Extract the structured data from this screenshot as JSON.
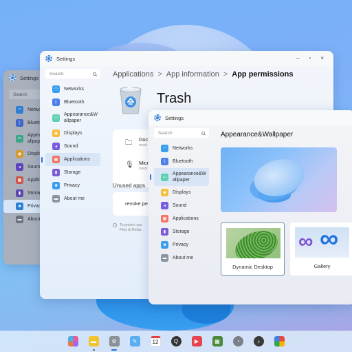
{
  "desktop": {
    "accent": "#2d6fd0"
  },
  "windows": {
    "back": {
      "title": "Settings",
      "search_placeholder": "Search",
      "nav": [
        {
          "label": "Networks",
          "icon": "wifi-icon",
          "color": "#2b7fd4"
        },
        {
          "label": "Bluetooth",
          "icon": "bluetooth-icon",
          "color": "#3f66c9"
        },
        {
          "label": "Appearance&Wallpaper",
          "line1": "Appea",
          "line2": "allpap",
          "icon": "wallpaper-icon",
          "color": "#3da58a"
        },
        {
          "label": "Displays",
          "icon": "display-icon",
          "color": "#d69b2d"
        },
        {
          "label": "Sound",
          "icon": "sound-icon",
          "color": "#5d43b8"
        },
        {
          "label": "Applications",
          "icon": "applications-icon",
          "color": "#c9564a"
        },
        {
          "label": "Storage",
          "icon": "storage-icon",
          "color": "#5a46b0"
        },
        {
          "label": "Privacy",
          "icon": "lock-icon",
          "color": "#2b7fd4",
          "active": true
        },
        {
          "label": "About me",
          "icon": "about-icon",
          "color": "#6d737d"
        }
      ]
    },
    "middle": {
      "title": "Settings",
      "controls": {
        "minimize": "–",
        "maximize": "▫",
        "close": "×"
      },
      "search_placeholder": "Search",
      "nav": [
        {
          "label": "Networks",
          "icon": "wifi-icon",
          "color": "#3b9ff0"
        },
        {
          "label": "Bluetooth",
          "icon": "bluetooth-icon",
          "color": "#4f7fe6"
        },
        {
          "label": "Appearance&Wallpaper",
          "line1": "Appearance&W",
          "line2": "allpaper",
          "icon": "wallpaper-icon",
          "color": "#5fcfb4"
        },
        {
          "label": "Displays",
          "icon": "display-icon",
          "color": "#f5be3c"
        },
        {
          "label": "Sound",
          "icon": "sound-icon",
          "color": "#7a5ce0"
        },
        {
          "label": "Applications",
          "icon": "applications-icon",
          "color": "#ef7564",
          "active": true
        },
        {
          "label": "Storage",
          "icon": "storage-icon",
          "color": "#7a5cd8"
        },
        {
          "label": "Privacy",
          "icon": "lock-icon",
          "color": "#3b9ff0"
        },
        {
          "label": "About me",
          "icon": "about-icon",
          "color": "#8c93a0"
        }
      ],
      "breadcrumb": [
        "Applications",
        "App information",
        "App permissions"
      ],
      "app_name": "Trash",
      "permissions": [
        {
          "title": "Doc",
          "subtitle": "medi",
          "icon": "folder-icon"
        },
        {
          "title": "Micr",
          "subtitle": "medi",
          "icon": "microphone-icon"
        }
      ],
      "unused_label": "Unused apps",
      "revoke_label": "revoke pe",
      "protect_line1": "To protect you",
      "protect_line2": "Files & Media"
    },
    "front": {
      "title": "Settings",
      "search_placeholder": "Search",
      "nav": [
        {
          "label": "Networks",
          "icon": "wifi-icon",
          "color": "#3b9ff0"
        },
        {
          "label": "Bluetooth",
          "icon": "bluetooth-icon",
          "color": "#4f7fe6"
        },
        {
          "label": "Appearance&Wallpaper",
          "line1": "Appearance&W",
          "line2": "allpaper",
          "icon": "wallpaper-icon",
          "color": "#5fcfb4",
          "active": true
        },
        {
          "label": "Displays",
          "icon": "display-icon",
          "color": "#f5be3c"
        },
        {
          "label": "Sound",
          "icon": "sound-icon",
          "color": "#7a5ce0"
        },
        {
          "label": "Applications",
          "icon": "applications-icon",
          "color": "#ef7564"
        },
        {
          "label": "Storage",
          "icon": "storage-icon",
          "color": "#7a5cd8"
        },
        {
          "label": "Privacy",
          "icon": "lock-icon",
          "color": "#3b9ff0"
        },
        {
          "label": "About me",
          "icon": "about-icon",
          "color": "#8c93a0"
        }
      ],
      "page_title": "Appearance&Wallpaper",
      "wallpapers": [
        {
          "label": "Dynamic Desktop",
          "selected": true
        },
        {
          "label": "Gallery",
          "selected": false
        }
      ]
    }
  },
  "taskbar": {
    "apps": [
      {
        "name": "app-launcher",
        "icon": "app-grid-icon",
        "color": "#e86bb0"
      },
      {
        "name": "file-manager",
        "icon": "folder-icon",
        "color": "#f2c231",
        "running": true
      },
      {
        "name": "settings",
        "icon": "settings-icon",
        "color": "#8a8f98",
        "active": true
      },
      {
        "name": "notes",
        "icon": "notes-icon",
        "color": "#5aaef0"
      },
      {
        "name": "calendar",
        "icon": "calendar-icon",
        "color": "#ffffff",
        "text": "12"
      },
      {
        "name": "search",
        "icon": "search-icon",
        "color": "#333333"
      },
      {
        "name": "video-player",
        "icon": "play-icon",
        "color": "#e8434f"
      },
      {
        "name": "calculator",
        "icon": "calculator-icon",
        "color": "#4a8a3a"
      },
      {
        "name": "clock",
        "icon": "clock-icon",
        "color": "#7a7f88"
      },
      {
        "name": "music",
        "icon": "music-icon",
        "color": "#3a3a3a"
      },
      {
        "name": "photos",
        "icon": "pinwheel-icon",
        "color": "#f0a020"
      }
    ]
  }
}
